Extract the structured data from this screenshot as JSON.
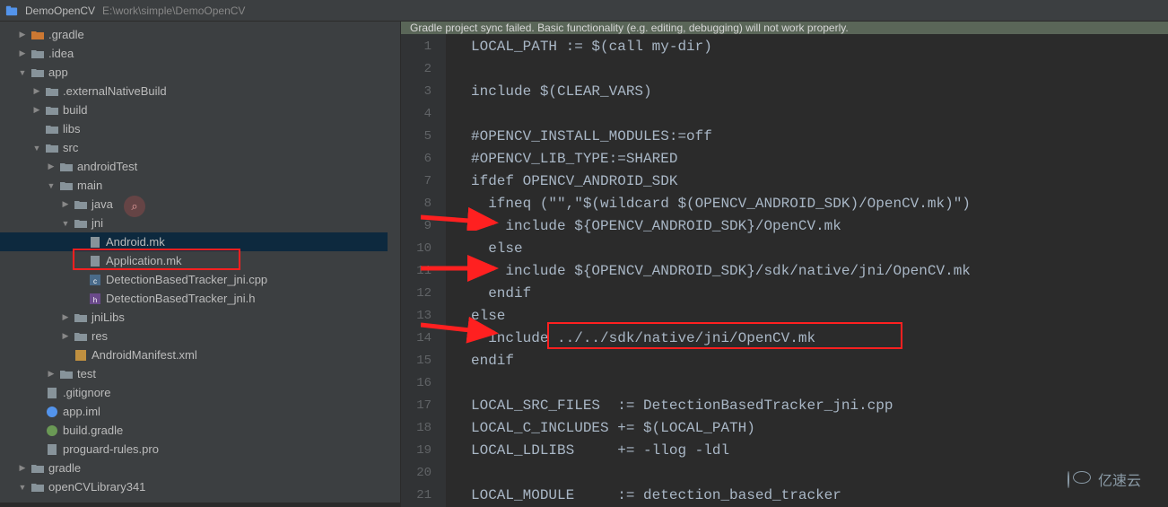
{
  "breadcrumb": {
    "project": "DemoOpenCV",
    "path": "E:\\work\\simple\\DemoOpenCV"
  },
  "notification": "Gradle project sync failed. Basic functionality (e.g. editing, debugging) will not work properly.",
  "watermark": "亿速云",
  "tree": [
    {
      "label": ".gradle",
      "indent": 1,
      "arrow": "right",
      "icon": "folder-orange"
    },
    {
      "label": ".idea",
      "indent": 1,
      "arrow": "right",
      "icon": "folder"
    },
    {
      "label": "app",
      "indent": 1,
      "arrow": "down",
      "icon": "folder"
    },
    {
      "label": ".externalNativeBuild",
      "indent": 2,
      "arrow": "right",
      "icon": "folder"
    },
    {
      "label": "build",
      "indent": 2,
      "arrow": "right",
      "icon": "folder"
    },
    {
      "label": "libs",
      "indent": 2,
      "arrow": "none",
      "icon": "folder"
    },
    {
      "label": "src",
      "indent": 2,
      "arrow": "down",
      "icon": "folder"
    },
    {
      "label": "androidTest",
      "indent": 3,
      "arrow": "right",
      "icon": "folder"
    },
    {
      "label": "main",
      "indent": 3,
      "arrow": "down",
      "icon": "folder"
    },
    {
      "label": "java",
      "indent": 4,
      "arrow": "right",
      "icon": "folder"
    },
    {
      "label": "jni",
      "indent": 4,
      "arrow": "down",
      "icon": "folder"
    },
    {
      "label": "Android.mk",
      "indent": 5,
      "arrow": "none",
      "icon": "file",
      "selected": true
    },
    {
      "label": "Application.mk",
      "indent": 5,
      "arrow": "none",
      "icon": "file"
    },
    {
      "label": "DetectionBasedTracker_jni.cpp",
      "indent": 5,
      "arrow": "none",
      "icon": "cpp"
    },
    {
      "label": "DetectionBasedTracker_jni.h",
      "indent": 5,
      "arrow": "none",
      "icon": "h"
    },
    {
      "label": "jniLibs",
      "indent": 4,
      "arrow": "right",
      "icon": "folder"
    },
    {
      "label": "res",
      "indent": 4,
      "arrow": "right",
      "icon": "folder"
    },
    {
      "label": "AndroidManifest.xml",
      "indent": 4,
      "arrow": "none",
      "icon": "xml"
    },
    {
      "label": "test",
      "indent": 3,
      "arrow": "right",
      "icon": "folder"
    },
    {
      "label": ".gitignore",
      "indent": 2,
      "arrow": "none",
      "icon": "file"
    },
    {
      "label": "app.iml",
      "indent": 2,
      "arrow": "none",
      "icon": "iml"
    },
    {
      "label": "build.gradle",
      "indent": 2,
      "arrow": "none",
      "icon": "gradle"
    },
    {
      "label": "proguard-rules.pro",
      "indent": 2,
      "arrow": "none",
      "icon": "file"
    },
    {
      "label": "gradle",
      "indent": 1,
      "arrow": "right",
      "icon": "folder"
    },
    {
      "label": "openCVLibrary341",
      "indent": 1,
      "arrow": "down",
      "icon": "folder"
    }
  ],
  "lines": [
    {
      "n": 1,
      "t": "LOCAL_PATH := $(call my-dir)"
    },
    {
      "n": 2,
      "t": ""
    },
    {
      "n": 3,
      "t": "include $(CLEAR_VARS)"
    },
    {
      "n": 4,
      "t": ""
    },
    {
      "n": 5,
      "t": "#OPENCV_INSTALL_MODULES:=off"
    },
    {
      "n": 6,
      "t": "#OPENCV_LIB_TYPE:=SHARED"
    },
    {
      "n": 7,
      "t": "ifdef OPENCV_ANDROID_SDK"
    },
    {
      "n": 8,
      "t": "  ifneq (\"\",\"$(wildcard $(OPENCV_ANDROID_SDK)/OpenCV.mk)\")"
    },
    {
      "n": 9,
      "t": "    include ${OPENCV_ANDROID_SDK}/OpenCV.mk"
    },
    {
      "n": 10,
      "t": "  else"
    },
    {
      "n": 11,
      "t": "    include ${OPENCV_ANDROID_SDK}/sdk/native/jni/OpenCV.mk"
    },
    {
      "n": 12,
      "t": "  endif"
    },
    {
      "n": 13,
      "t": "else"
    },
    {
      "n": 14,
      "t": "  include ../../sdk/native/jni/OpenCV.mk"
    },
    {
      "n": 15,
      "t": "endif"
    },
    {
      "n": 16,
      "t": ""
    },
    {
      "n": 17,
      "t": "LOCAL_SRC_FILES  := DetectionBasedTracker_jni.cpp"
    },
    {
      "n": 18,
      "t": "LOCAL_C_INCLUDES += $(LOCAL_PATH)"
    },
    {
      "n": 19,
      "t": "LOCAL_LDLIBS     += -llog -ldl"
    },
    {
      "n": 20,
      "t": ""
    },
    {
      "n": 21,
      "t": "LOCAL_MODULE     := detection_based_tracker"
    }
  ]
}
